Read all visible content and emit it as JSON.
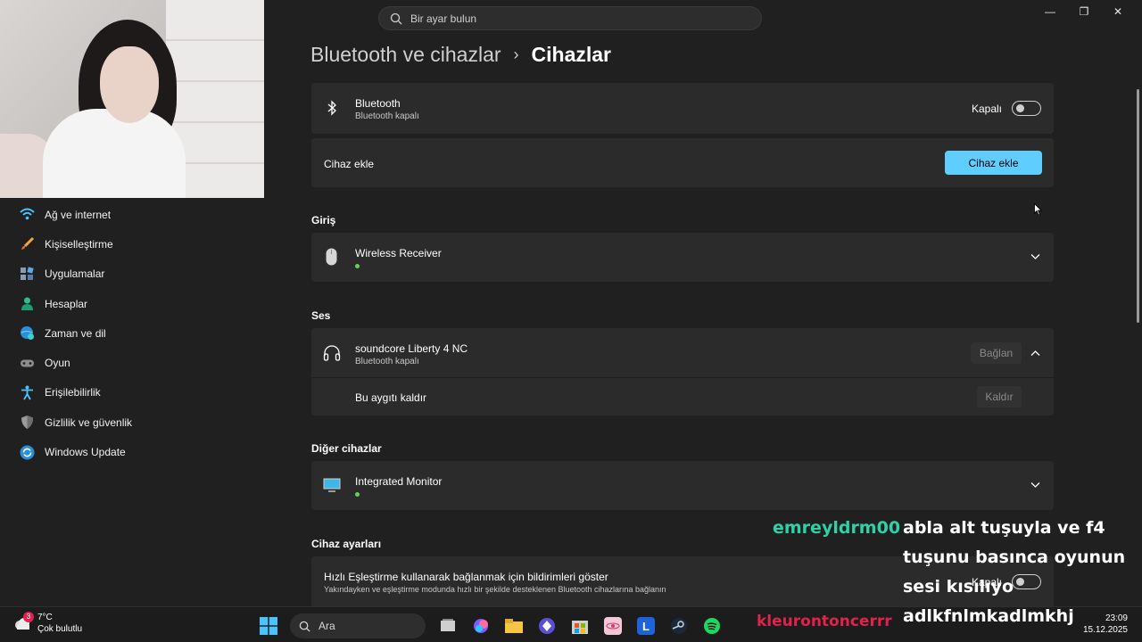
{
  "search": {
    "placeholder": "Bir ayar bulun"
  },
  "window_controls": {
    "minimize": "—",
    "maximize": "❐",
    "close": "✕"
  },
  "sidebar": {
    "items": [
      {
        "label": "Ağ ve internet",
        "icon": "wifi-icon"
      },
      {
        "label": "Kişiselleştirme",
        "icon": "brush-icon"
      },
      {
        "label": "Uygulamalar",
        "icon": "apps-icon"
      },
      {
        "label": "Hesaplar",
        "icon": "account-icon"
      },
      {
        "label": "Zaman ve dil",
        "icon": "globe-clock-icon"
      },
      {
        "label": "Oyun",
        "icon": "gamepad-icon"
      },
      {
        "label": "Erişilebilirlik",
        "icon": "accessibility-icon"
      },
      {
        "label": "Gizlilik ve güvenlik",
        "icon": "shield-icon"
      },
      {
        "label": "Windows Update",
        "icon": "update-icon"
      }
    ]
  },
  "breadcrumb": {
    "parent": "Bluetooth ve cihazlar",
    "separator": "›",
    "current": "Cihazlar"
  },
  "bluetooth": {
    "title": "Bluetooth",
    "subtitle": "Bluetooth kapalı",
    "toggle_label": "Kapalı",
    "toggle_on": false
  },
  "add_device": {
    "label": "Cihaz ekle",
    "button": "Cihaz ekle"
  },
  "sections": {
    "input": "Giriş",
    "audio": "Ses",
    "other": "Diğer cihazlar",
    "settings": "Cihaz ayarları"
  },
  "devices": {
    "wireless_receiver": {
      "name": "Wireless Receiver",
      "connected": true
    },
    "soundcore": {
      "name": "soundcore Liberty 4 NC",
      "status": "Bluetooth kapalı",
      "connect_button": "Bağlan",
      "remove_label": "Bu aygıtı kaldır",
      "remove_button": "Kaldır"
    },
    "monitor": {
      "name": "Integrated Monitor",
      "connected": true
    }
  },
  "swift_pair": {
    "title": "Hızlı Eşleştirme kullanarak bağlanmak için bildirimleri göster",
    "subtitle": "Yakındayken ve eşleştirme modunda hızlı bir şekilde desteklenen Bluetooth cihazlarına bağlanın",
    "toggle_label": "Kapalı"
  },
  "chat": {
    "username": "emreyldrm00",
    "message": "abla alt tuşuyla ve f4 tuşunu basınca oyunun sesi kısılıyo adlkfnlmkadlmkhj",
    "username2": "kleurontoncerrr"
  },
  "taskbar": {
    "weather_temp": "7°C",
    "weather_desc": "Çok bulutlu",
    "weather_badge": "3",
    "search_label": "Ara",
    "time": "23:09",
    "date": "15.12.2025"
  },
  "colors": {
    "accent": "#60cdff",
    "background": "#202020",
    "card": "#2b2b2b",
    "chat_user": "#2fd1a6",
    "status_green": "#6ccb5f"
  }
}
